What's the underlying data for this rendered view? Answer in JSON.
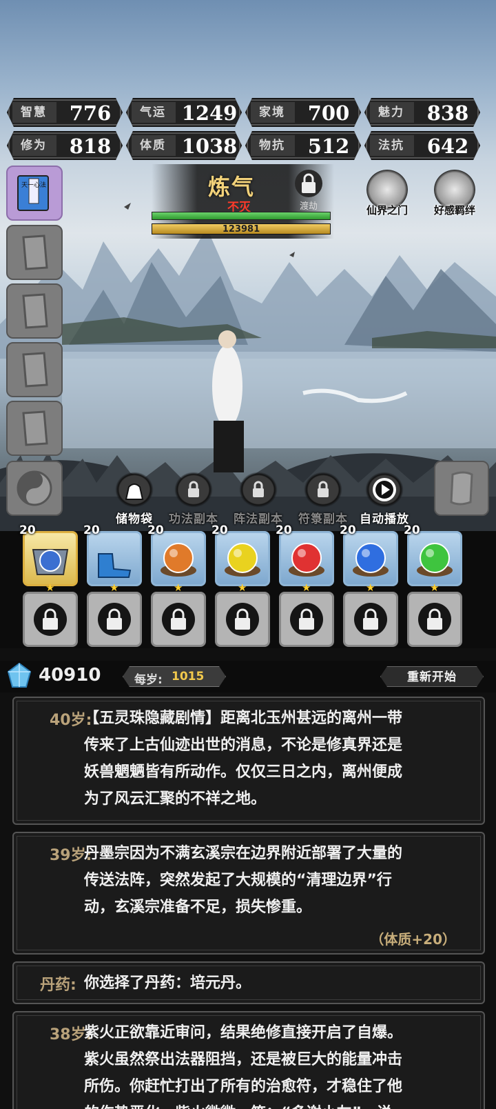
{
  "stats": [
    {
      "label": "智慧",
      "value": "776"
    },
    {
      "label": "气运",
      "value": "1249"
    },
    {
      "label": "家境",
      "value": "700"
    },
    {
      "label": "魅力",
      "value": "838"
    },
    {
      "label": "修为",
      "value": "818"
    },
    {
      "label": "体质",
      "value": "1038"
    },
    {
      "label": "物抗",
      "value": "512"
    },
    {
      "label": "法抗",
      "value": "642"
    }
  ],
  "sidebar": {
    "active_book_label": "天一心法"
  },
  "realm": {
    "name": "炼气",
    "sub": "不灭",
    "lock_label": "渡劫",
    "green_progress": 1.0,
    "gold_progress": 1.0,
    "gold_value": "123981"
  },
  "top_buttons": [
    {
      "label": "仙界之门",
      "icon": "gate-icon"
    },
    {
      "label": "好感羁绊",
      "icon": "bond-icon"
    }
  ],
  "actions": [
    {
      "label": "储物袋",
      "icon": "bag-icon",
      "locked": false
    },
    {
      "label": "功法副本",
      "icon": "lock-icon",
      "locked": true
    },
    {
      "label": "阵法副本",
      "icon": "lock-icon",
      "locked": true
    },
    {
      "label": "符箓副本",
      "icon": "lock-icon",
      "locked": true
    },
    {
      "label": "自动播放",
      "icon": "play-icon",
      "locked": false
    }
  ],
  "slots": [
    {
      "level": "20",
      "kind": "armor",
      "color": "#3b6fd1"
    },
    {
      "level": "20",
      "kind": "boots",
      "color": "#2f7fd0"
    },
    {
      "level": "20",
      "kind": "orb",
      "color": "#e07a2a"
    },
    {
      "level": "20",
      "kind": "orb",
      "color": "#e9d21f"
    },
    {
      "level": "20",
      "kind": "orb",
      "color": "#e03232"
    },
    {
      "level": "20",
      "kind": "orb",
      "color": "#2f6ee0"
    },
    {
      "level": "20",
      "kind": "orb",
      "color": "#3fc43f"
    }
  ],
  "resources": {
    "spirit_stones": "40910",
    "per_year_label": "每岁:",
    "per_year_value": "1015",
    "restart_label": "重新开始"
  },
  "log": [
    {
      "age": "40岁:",
      "lines": [
        "【五灵珠隐藏剧情】距离北玉州甚远的离州一带",
        "传来了上古仙迹出世的消息，不论是修真界还是",
        "妖兽魍魉皆有所动作。仅仅三日之内，离州便成",
        "为了风云汇聚的不祥之地。"
      ]
    },
    {
      "age": "39岁:",
      "lines": [
        "丹墨宗因为不满玄溪宗在边界附近部署了大量的",
        "传送法阵，突然发起了大规模的“清理边界”行",
        "动，玄溪宗准备不足，损失惨重。"
      ],
      "bonus": "（体质+20）"
    },
    {
      "age": "丹药:",
      "lines": [
        "你选择了丹药：培元丹。"
      ]
    },
    {
      "age": "38岁:",
      "lines": [
        "紫火正欲靠近审问，结果绝修直接开启了自爆。",
        "紫火虽然祭出法器阻挡，还是被巨大的能量冲击",
        "所伤。你赶忙打出了所有的治愈符，才稳住了他",
        "的伤势恶化。紫火微微一笑：“多谢小友”，说"
      ]
    }
  ]
}
